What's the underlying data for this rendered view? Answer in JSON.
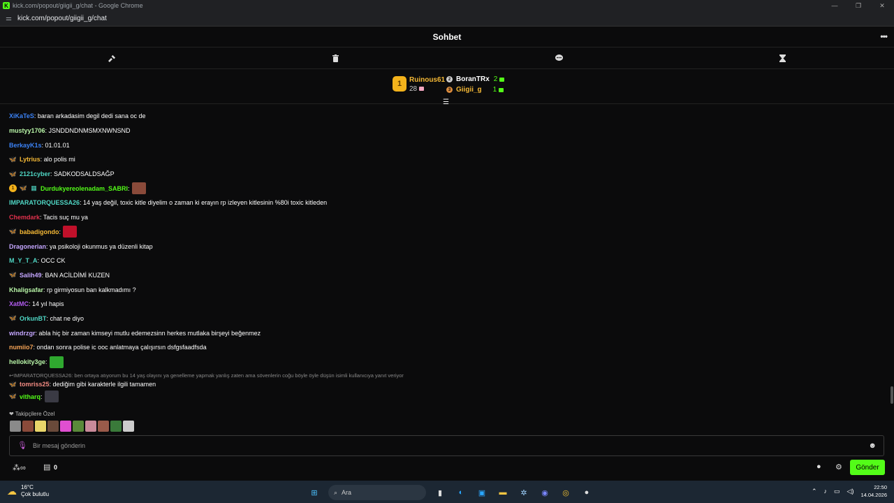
{
  "window": {
    "title": "kick.com/popout/giigii_g/chat - Google Chrome",
    "url": "kick.com/popout/giigii_g/chat"
  },
  "header": {
    "title": "Sohbet"
  },
  "leaderboard": {
    "first": {
      "rank": "1",
      "name": "Ruinous61",
      "count": "28"
    },
    "second": {
      "name": "BoranTRx",
      "count": "2"
    },
    "third": {
      "name": "Giigii_g",
      "count": "1"
    }
  },
  "messages": [
    {
      "user": "XiKaTeS",
      "color": "#3b82f6",
      "text": ": baran arkadasim degil dedi sana oc de",
      "badges": []
    },
    {
      "user": "mustyy1706",
      "color": "#b9f6a8",
      "text": ": JSNDDNDNMSMXNWNSND",
      "badges": []
    },
    {
      "user": "BerkayK1s",
      "color": "#3b82f6",
      "text": ": 01.01.01",
      "badges": []
    },
    {
      "user": "Lytrius",
      "color": "#f5b936",
      "text": ": alo polis mi",
      "badges": [
        "butterfly"
      ]
    },
    {
      "user": "2121cyber",
      "color": "#4fd6c4",
      "text": ": SADKODSALDSAĞP",
      "badges": [
        "butterfly"
      ]
    },
    {
      "user": "Durdukyereolenadam_SABRI",
      "color": "#53fc18",
      "text": ":",
      "badges": [
        "gold",
        "butterfly",
        "gift"
      ],
      "emote": "#8a4a3a"
    },
    {
      "user": "IMPARATORQUESSA26",
      "color": "#4fd6c4",
      "text": ": 14 yaş değil, toxic kitle diyelim o zaman ki erayın rp izleyen kitlesinin %80i toxic kitleden",
      "badges": []
    },
    {
      "user": "Chemdark",
      "color": "#e0314c",
      "text": ": Tacis suç mu ya",
      "badges": []
    },
    {
      "user": "babadigondo",
      "color": "#f5b936",
      "text": ":",
      "badges": [
        "butterfly"
      ],
      "emote": "#c0102a"
    },
    {
      "user": "Dragonerian",
      "color": "#c4a6ff",
      "text": ": ya psikoloji okunmus ya düzenli kitap",
      "badges": []
    },
    {
      "user": "M_Y_T_A",
      "color": "#4fd6c4",
      "text": ": OCC CK",
      "badges": []
    },
    {
      "user": "Salih49",
      "color": "#c4a6ff",
      "text": ": BAN ACİLDİMİ KUZEN",
      "badges": [
        "butterfly"
      ]
    },
    {
      "user": "Khaligsafar",
      "color": "#b9f6a8",
      "text": ": rp girmiyosun ban kalkmadımı ?",
      "badges": []
    },
    {
      "user": "XatMC",
      "color": "#b25cf0",
      "text": ": 14 yıl hapis",
      "badges": []
    },
    {
      "user": "OrkunBT",
      "color": "#4fd6c4",
      "text": ": chat ne diyo",
      "badges": [
        "butterfly"
      ]
    },
    {
      "user": "windrzgr",
      "color": "#c4a6ff",
      "text": ": abla hiç bir zaman kimseyi mutlu edemezsinn herkes mutlaka birşeyi beğenmez",
      "badges": []
    },
    {
      "user": "numiio7",
      "color": "#f5a356",
      "text": ": ondan sonra polise ic ooc anlatmaya çalışırsın dsfgsfaadfsda",
      "badges": []
    },
    {
      "user": "hellokity3ge",
      "color": "#b9f6a8",
      "text": ":",
      "badges": [],
      "emote": "#2fa82f"
    }
  ],
  "reply": {
    "context": "IMPARATORQUESSA26: ben ortaya atıyorum bu 14 yaş olayını ya genelleme yapmak yanlış zaten ama sövenlerin coğu böyle öyle düşün isimli kullanıcıya yanıt veriyor",
    "user": "tomriss25",
    "color": "#f28b82",
    "text": ": dediğim gibi karakterle ilgili tamamen"
  },
  "last_message": {
    "user": "vitharq",
    "color": "#53fc18",
    "text": ":"
  },
  "followers_only": "Takipçilere Özel",
  "input": {
    "placeholder": "Bir mesaj gönderin"
  },
  "points": "0",
  "send_label": "Gönder",
  "taskbar": {
    "weather_temp": "16°C",
    "weather_desc": "Çok bulutlu",
    "search_placeholder": "Ara",
    "time": "22:50",
    "date": "14.04.2026"
  },
  "colors": {
    "accent": "#53fc18",
    "background": "#0b0b0c",
    "gold": "#f3b21b"
  }
}
